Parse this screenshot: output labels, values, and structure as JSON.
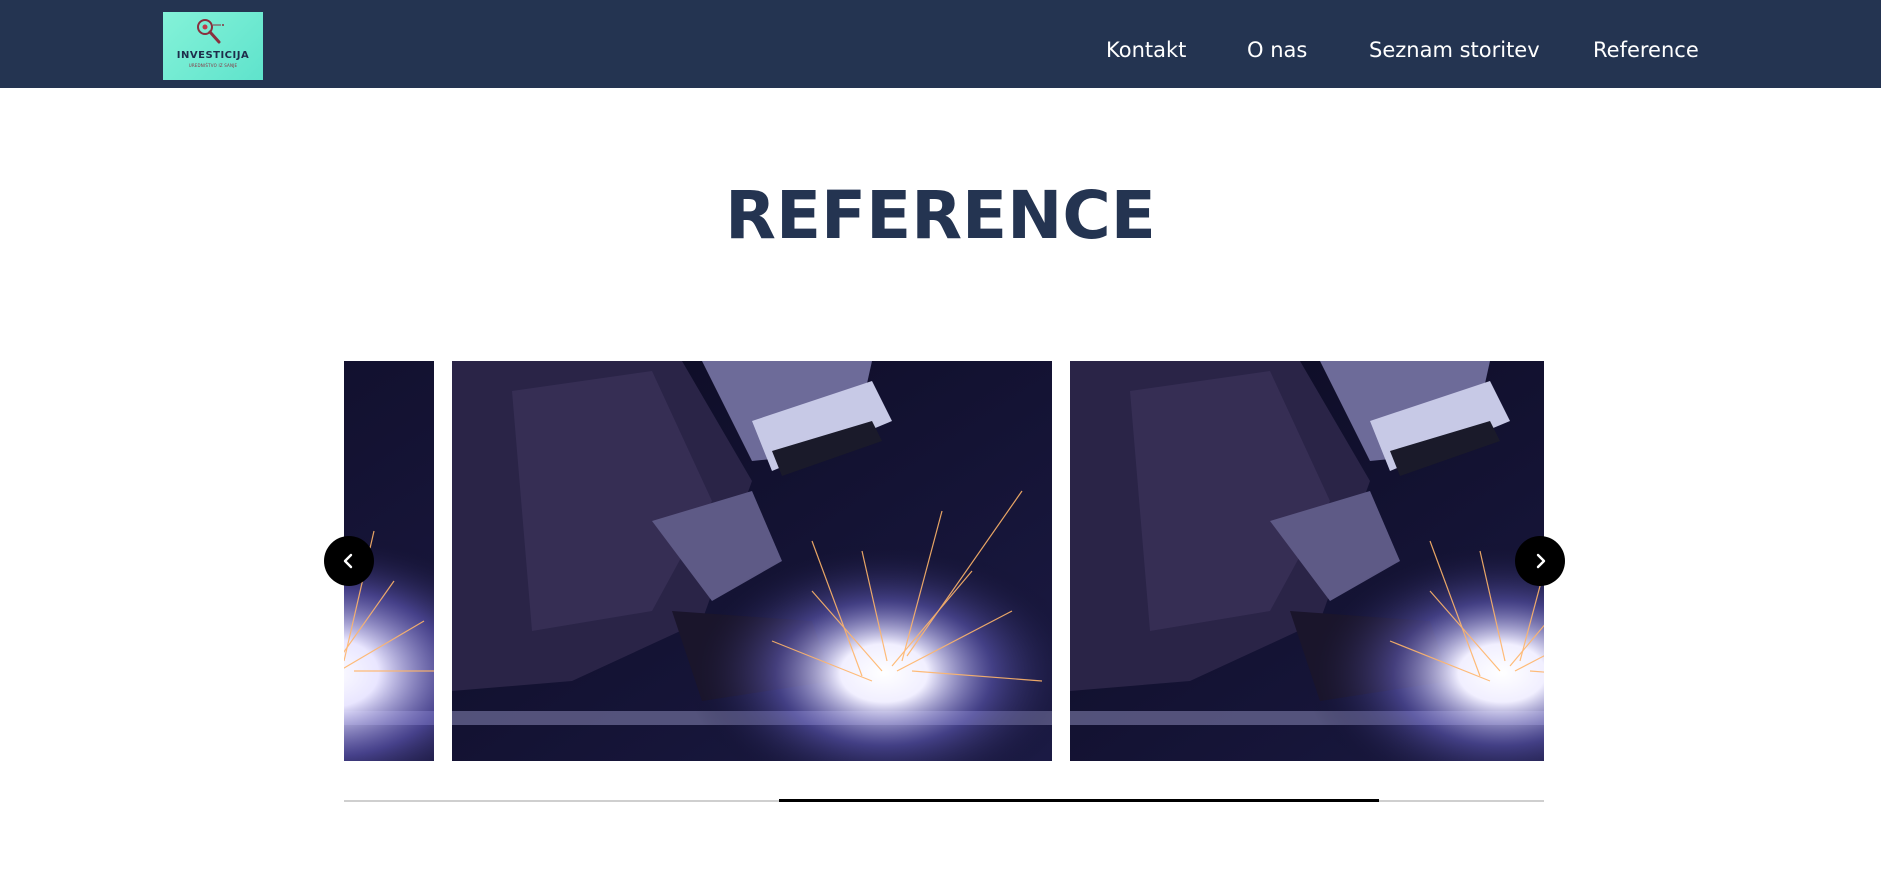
{
  "header": {
    "logo": {
      "title": "INVESTICIJA",
      "subtitle": "UREDNIŠTVO IZ SANJE",
      "icon": "magnifier-icon"
    },
    "nav": [
      {
        "label": "Kontakt"
      },
      {
        "label": "O nas"
      },
      {
        "label": "Seznam storitev"
      },
      {
        "label": "Reference"
      }
    ]
  },
  "main": {
    "title": "REFERENCE",
    "carousel": {
      "slide_count_visible": 3,
      "slides": [
        {
          "image": "welder-sparks-photo"
        },
        {
          "image": "welder-sparks-photo"
        },
        {
          "image": "welder-sparks-photo"
        }
      ],
      "prev_icon": "chevron-left-icon",
      "next_icon": "chevron-right-icon",
      "scroll_progress": 0.45
    }
  },
  "colors": {
    "header_bg": "#243451",
    "title": "#243451",
    "logo_bg": "#7eecd5",
    "arrow_bg": "#000000",
    "scroll_track": "#cfcfcf",
    "scroll_thumb": "#000000"
  }
}
